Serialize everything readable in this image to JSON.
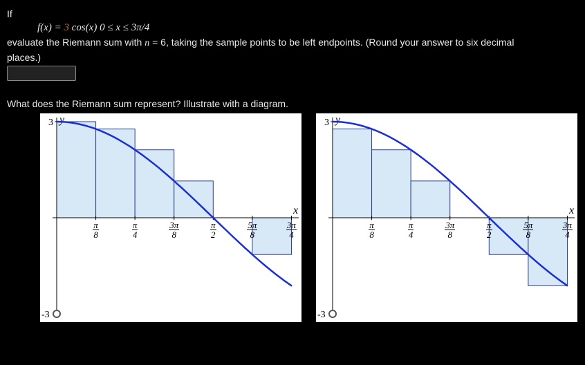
{
  "problem": {
    "lead": "If",
    "fx_lhs": "f(x) = ",
    "fx_coef": "3",
    "fx_rhs": " cos(x)    0 ≤ x ≤ 3π/4",
    "instr_a": "evaluate the Riemann sum with ",
    "nvar": "n",
    "instr_b": " = 6,  taking the sample points to be left endpoints. (Round your answer to six decimal",
    "instr_c": "places.)",
    "q2": "What does the Riemann sum represent? Illustrate with a diagram."
  },
  "chart_data": [
    {
      "type": "bar",
      "title": "",
      "xlabel": "x",
      "ylabel": "y",
      "ylim": [
        -3,
        3
      ],
      "xlim": [
        0,
        2.36
      ],
      "categories": [
        "π/8",
        "π/4",
        "3π/8",
        "π/2",
        "5π/8",
        "3π/4"
      ],
      "x_left": [
        0,
        0.3927,
        0.7854,
        1.1781,
        1.5708,
        1.9635
      ],
      "values": [
        3.0,
        2.7716,
        2.1213,
        1.1481,
        0.0,
        -1.1481
      ],
      "curve": "3cos(x)",
      "description": "Left-endpoint Riemann sum rectangles under y=3cos(x) on [0,3π/4]"
    },
    {
      "type": "bar",
      "title": "",
      "xlabel": "x",
      "ylabel": "y",
      "ylim": [
        -3,
        3
      ],
      "xlim": [
        0,
        2.36
      ],
      "categories": [
        "π/8",
        "π/4",
        "3π/8",
        "π/2",
        "5π/8",
        "3π/4"
      ],
      "x_left": [
        0,
        0.3927,
        0.7854,
        1.1781,
        1.5708,
        1.9635
      ],
      "values": [
        2.7716,
        2.1213,
        1.1481,
        0.0,
        -1.1481,
        -2.1213
      ],
      "curve": "3cos(x)",
      "description": "Right-endpoint Riemann sum rectangles under y=3cos(x) on [0,3π/4]"
    }
  ],
  "axis": {
    "y_label": "y",
    "x_label": "x",
    "y_max": "3",
    "y_min": "-3",
    "ticks": [
      {
        "num": "π",
        "den": "8"
      },
      {
        "num": "π",
        "den": "4"
      },
      {
        "num": "3π",
        "den": "8"
      },
      {
        "num": "π",
        "den": "2"
      },
      {
        "num": "5π",
        "den": "8"
      },
      {
        "num": "3π",
        "den": "4"
      }
    ]
  }
}
